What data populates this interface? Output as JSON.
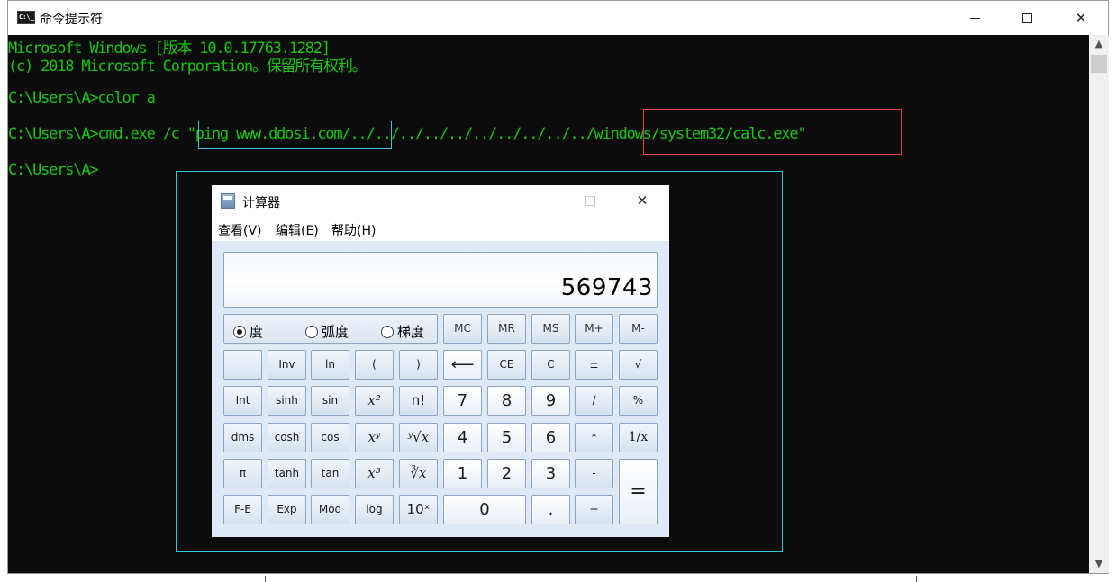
{
  "console_window": {
    "title": "命令提示符",
    "icon": "console-icon",
    "lines": [
      "Microsoft Windows [版本 10.0.17763.1282]",
      "(c) 2018 Microsoft Corporation。保留所有权利。",
      "C:\\Users\\A>color a",
      "C:\\Users\\A>cmd.exe /c \"ping www.ddosi.com/../../../../../../../../../../windows/system32/calc.exe\"",
      "C:\\Users\\A>"
    ],
    "text_color": "#16c60c",
    "background": "#0c0c0c"
  },
  "highlights": {
    "cyan_color": "#33c8d8",
    "red_color": "#e04040"
  },
  "calculator": {
    "title": "计算器",
    "menu": [
      "查看(V)",
      "编辑(E)",
      "帮助(H)"
    ],
    "display_value": "569743",
    "angle_modes": [
      {
        "label": "度",
        "selected": true
      },
      {
        "label": "弧度",
        "selected": false
      },
      {
        "label": "梯度",
        "selected": false
      }
    ],
    "memory_buttons": [
      "MC",
      "MR",
      "MS",
      "M+",
      "M-"
    ],
    "rows": {
      "row1": [
        "",
        "Inv",
        "ln",
        "(",
        ")",
        "⟵",
        "CE",
        "C",
        "±",
        "√"
      ],
      "row2": [
        "Int",
        "sinh",
        "sin",
        "x²",
        "n!",
        "7",
        "8",
        "9",
        "/",
        "%"
      ],
      "row3": [
        "dms",
        "cosh",
        "cos",
        "xʸ",
        "ʸ√x",
        "4",
        "5",
        "6",
        "*",
        "1/x"
      ],
      "row4": [
        "π",
        "tanh",
        "tan",
        "x³",
        "∛x",
        "1",
        "2",
        "3",
        "-",
        "="
      ],
      "row5": [
        "F-E",
        "Exp",
        "Mod",
        "log",
        "10ˣ",
        "0",
        ".",
        "+"
      ]
    }
  }
}
